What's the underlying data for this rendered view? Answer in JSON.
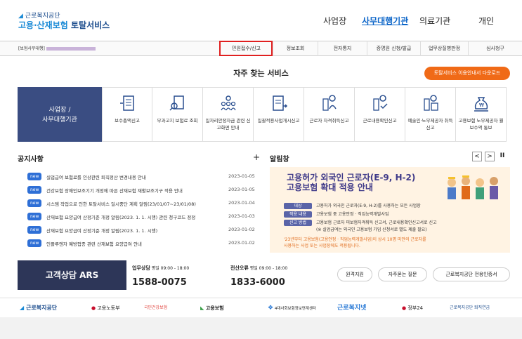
{
  "header": {
    "org": "근로복지공단",
    "title_part1": "고용·산재보험",
    "title_part2": "토탈서비스",
    "nav": [
      "사업장",
      "사무대행기관",
      "의료기관",
      "개인"
    ]
  },
  "menubar": {
    "user_label": "[보험사무대행]",
    "items": [
      "민원접수/신고",
      "정보조회",
      "전자통지",
      "증명원 신청/발급",
      "업무상질병판정",
      "심사청구"
    ]
  },
  "services": {
    "title": "자주 찾는 서비스",
    "download_label": "토탈서비스 이용안내서 다운로드",
    "box_label": "사업장 /\n사무대행기관",
    "items": [
      {
        "label": "보수총액신고",
        "icon": "document-list-icon"
      },
      {
        "label": "부과고지 보험료 조회",
        "icon": "document-search-icon"
      },
      {
        "label": "일자리안정자금 관련 신고화면 안내",
        "icon": "people-group-icon"
      },
      {
        "label": "일괄적용사업개시신고",
        "icon": "document-arrow-icon"
      },
      {
        "label": "근로자 자격취득신고",
        "icon": "person-add-icon"
      },
      {
        "label": "근로내용확인신고",
        "icon": "person-check-icon"
      },
      {
        "label": "예술인·노무제공자 취득신고",
        "icon": "person-doc-icon"
      },
      {
        "label": "고용보험 노무제공자 월보수액 통보",
        "icon": "money-bag-icon"
      }
    ]
  },
  "notice": {
    "title": "공지사항",
    "more": "+",
    "badge": "new",
    "items": [
      {
        "title": "실업급여 보험료를 인상관련 퇴직정산 변경내용 안내",
        "date": "2023-01-05"
      },
      {
        "title": "건강보험 장애인보조기기 개정에 따른 산재보험 재활보조기구 적용 안내",
        "date": "2023-01-05"
      },
      {
        "title": "시스템 작업으로 인한 토탈서비스 일시중단 계획 알림(23/01/07~23/01/08)",
        "date": "2023-01-04"
      },
      {
        "title": "산재보험 요양급여 산정기준 개정 알림(2023. 1. 1. 시행) 관련 청구코드 정정",
        "date": "2023-01-03"
      },
      {
        "title": "산재보험 요양급여 산정기준 개정 알림(2023. 1. 1. 시행)",
        "date": "2023-01-02"
      },
      {
        "title": "인플루엔자 예방접종 관련 산재보험 요양급여 안내",
        "date": "2023-01-02"
      }
    ]
  },
  "alarm": {
    "title": "알림창",
    "controls": [
      "<",
      ">",
      "II"
    ],
    "banner_h1": "고용허가 외국인 근로자(E-9, H-2)",
    "banner_h2": "고용보험 확대 적용 안내",
    "rows": [
      {
        "tag": "대상",
        "val": "고용허가 외국인 근로자(E-9, H-2)를 사용하는 모든 사업장"
      },
      {
        "tag": "적용 내용",
        "val": "고용보험 중 고용안정 · 직업능력개발사업"
      },
      {
        "tag": "신고 방법",
        "val": "고용보험 근로자 피보험자격취득 신고서, 근로내용확인신고서로 신고"
      }
    ],
    "row_note": "(※ 실업급여는 외국인 고용보험 가입 신청서로 별도 제출 필요)",
    "note1": "'23년부터 고용보험(고용안정 · 직업능력개발사업)이 상시 10명 미만의 근로자를",
    "note2": "사용하는 사업 또는 사업장에도 적용됩니다."
  },
  "ars": {
    "label": "고객상담 ARS",
    "phones": [
      {
        "title": "업무상담",
        "hours": "평일 09:00 - 18:00",
        "number": "1588-0075"
      },
      {
        "title": "전산오류",
        "hours": "평일 09:00 - 18:00",
        "number": "1833-6000"
      }
    ],
    "buttons": [
      "원격지원",
      "자주묻는 질문",
      "근로복지공단 전용인증서"
    ]
  },
  "footer": {
    "logos": [
      "근로복지공단",
      "고용노동부",
      "국민건강보험",
      "고용보험",
      "4대사회보험정보연계센터",
      "근로복지넷",
      "정부24",
      "근로복지공단 퇴직연금"
    ]
  },
  "colors": {
    "brand_blue": "#1a4b8c",
    "accent_orange": "#f06a17",
    "nav_active": "#0a64c8",
    "badge_blue": "#2e6fd6",
    "highlight_red": "#e02020"
  }
}
